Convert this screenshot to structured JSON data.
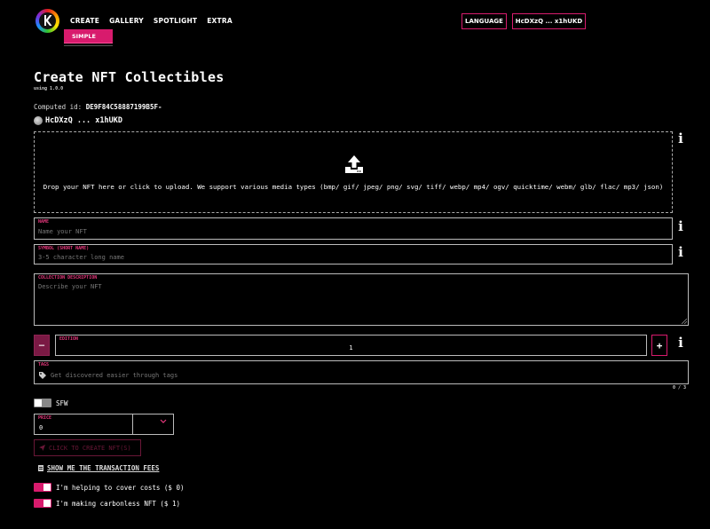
{
  "header": {
    "nav": [
      "CREATE",
      "GALLERY",
      "SPOTLIGHT",
      "EXTRA"
    ],
    "submenu_item": "SIMPLE",
    "language_button": "LANGUAGE",
    "wallet_button": "HcDXzQ ... x1hUKD"
  },
  "page": {
    "title": "Create NFT Collectibles",
    "version": "using 1.0.0",
    "computed_label": "Computed id:",
    "computed_id": "DE9F84C58887199B5F-",
    "account": "HcDXzQ ... x1hUKD"
  },
  "upload": {
    "text": "Drop your NFT here or click to upload. We support various media types (bmp/ gif/ jpeg/ png/ svg/ tiff/ webp/ mp4/ ogv/ quicktime/ webm/ glb/ flac/ mp3/ json)"
  },
  "form": {
    "name": {
      "label": "NAME",
      "placeholder": "Name your NFT"
    },
    "symbol": {
      "label": "SYMBOL (SHORT NAME)",
      "placeholder": "3-5 character long name"
    },
    "description": {
      "label": "COLLECTION DESCRIPTION",
      "placeholder": "Describe your NFT"
    },
    "edition": {
      "label": "EDITION",
      "value": "1",
      "minus": "−",
      "plus": "+"
    },
    "tags": {
      "label": "TAGS",
      "placeholder": "Get discovered easier through tags",
      "counter": "0 / 3"
    },
    "sfw": {
      "label": "SFW",
      "on": false
    },
    "price": {
      "label": "PRICE",
      "value": "0"
    },
    "create_button": "CLICK TO CREATE NFT(S)",
    "fees_link": "SHOW ME THE TRANSACTION FEES",
    "cover_costs": {
      "label": "I'm helping to cover costs ($ 0)",
      "on": true
    },
    "carbonless": {
      "label": "I'm making carbonless NFT ($ 1)",
      "on": true
    }
  },
  "icons": {
    "info": "i",
    "upload": "upload-icon",
    "tag": "tag-icon",
    "chevron": "chevron-down-icon",
    "send": "send-icon",
    "receipt": "receipt-icon"
  },
  "colors": {
    "accent": "#d81b6d",
    "label_pink": "#e5387c",
    "background": "#000000"
  }
}
